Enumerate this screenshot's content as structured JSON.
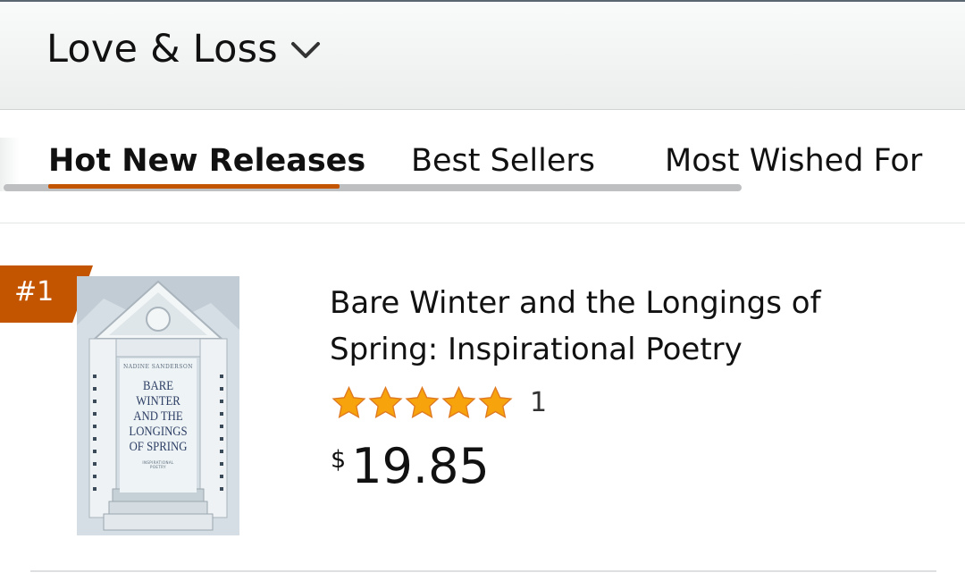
{
  "header": {
    "category": "Love & Loss",
    "dropdown_icon": "chevron-down-icon"
  },
  "tabs": [
    {
      "label": "Hot New Releases",
      "active": true
    },
    {
      "label": "Best Sellers",
      "active": false
    },
    {
      "label": "Most Wished For",
      "active": false
    }
  ],
  "colors": {
    "accent": "#c45500",
    "star": "#f7a30c",
    "text": "#111111"
  },
  "item": {
    "rank": "#1",
    "title": "Bare Winter and the Longings of Spring: Inspirational Poetry",
    "rating_stars": 5,
    "rating_count": "1",
    "price_symbol": "$",
    "price_value": "19.85",
    "cover": {
      "author": "Nadine Sanderson",
      "title": "BARE WINTER AND THE LONGINGS OF SPRING",
      "subtitle": "INSPIRATIONAL POETRY"
    }
  }
}
